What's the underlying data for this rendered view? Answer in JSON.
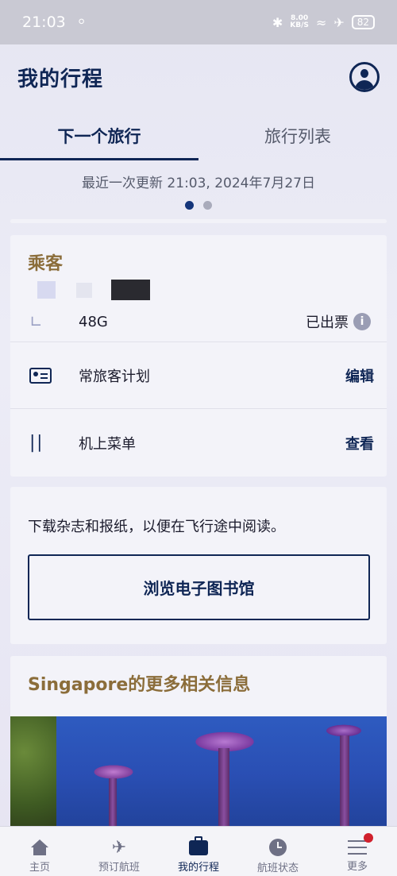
{
  "status_bar": {
    "time": "21:03",
    "notification_icon": "notification-icon",
    "net_speed_value": "8.00",
    "net_speed_unit": "KB/S",
    "battery": "82"
  },
  "header": {
    "title": "我的行程",
    "profile_icon": "profile-icon"
  },
  "tabs": [
    {
      "label": "下一个旅行",
      "active": true
    },
    {
      "label": "旅行列表",
      "active": false
    }
  ],
  "last_update": "最近一次更新 21:03, 2024年7月27日",
  "pager": {
    "count": 2,
    "active_index": 0
  },
  "passenger_card": {
    "title": "乘客",
    "seat": {
      "icon": "seat-icon",
      "value": "48G",
      "status": "已出票",
      "info_icon": "info-icon"
    },
    "frequent_flyer": {
      "icon": "membership-card-icon",
      "label": "常旅客计划",
      "action": "编辑"
    },
    "menu": {
      "icon": "cutlery-icon",
      "label": "机上菜单",
      "action": "查看"
    }
  },
  "library_card": {
    "description": "下载杂志和报纸，以便在飞行途中阅读。",
    "button_label": "浏览电子图书馆"
  },
  "destination_card": {
    "title": "Singapore的更多相关信息"
  },
  "bottom_nav": [
    {
      "label": "主页",
      "icon": "home-icon",
      "active": false
    },
    {
      "label": "预订航班",
      "icon": "airplane-icon",
      "active": false
    },
    {
      "label": "我的行程",
      "icon": "briefcase-icon",
      "active": true
    },
    {
      "label": "航班状态",
      "icon": "clock-icon",
      "active": false
    },
    {
      "label": "更多",
      "icon": "menu-icon",
      "active": false,
      "badge": true
    }
  ],
  "colors": {
    "primary": "#0f2655",
    "accent_gold": "#8b6d3a",
    "badge_red": "#d0202c",
    "background": "#e9e9f4"
  }
}
